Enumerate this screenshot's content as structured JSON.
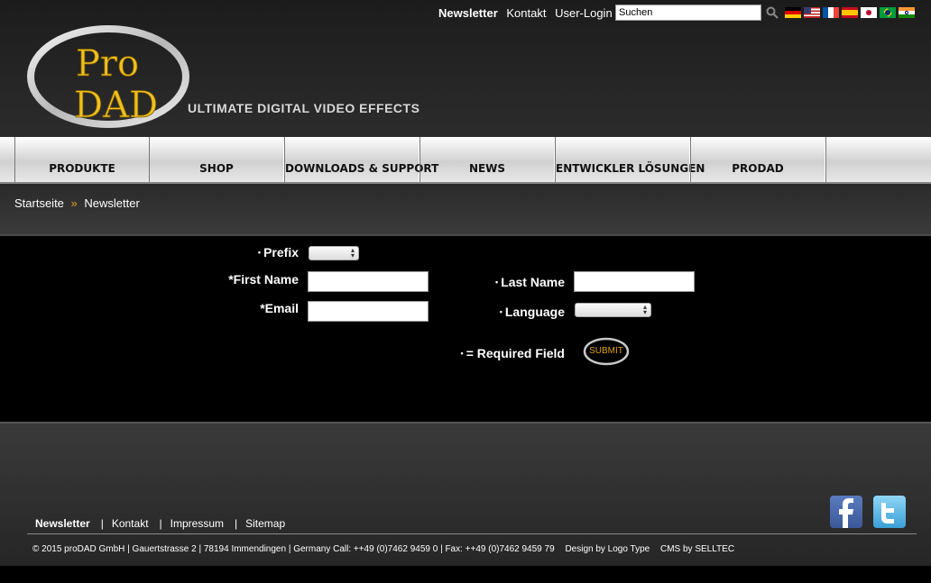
{
  "top_links": [
    "Newsletter",
    "Kontakt",
    "User-Login"
  ],
  "search": {
    "placeholder": "Suchen",
    "value": "Suchen"
  },
  "flags": [
    "de-flag",
    "us-flag",
    "fr-flag",
    "es-flag",
    "jp-flag",
    "br-flag",
    "in-flag"
  ],
  "logo": {
    "line1": "Pro",
    "line2": "DAD"
  },
  "slogan": "ULTIMATE DIGITAL VIDEO EFFECTS",
  "nav": [
    "PRODUKTE",
    "SHOP",
    "DOWNLOADS & SUPPORT",
    "NEWS",
    "ENTWICKLER LÖSUNGEN",
    "PRODAD"
  ],
  "breadcrumb": {
    "home": "Startseite",
    "separator": "»",
    "current": "Newsletter"
  },
  "form": {
    "prefix_label": "Prefix",
    "first_name_label": "*First Name",
    "email_label": "*Email",
    "last_name_label": "Last Name",
    "language_label": "Language",
    "required_note": "= Required Field",
    "submit_label": "SUBMIT"
  },
  "footer": {
    "links": [
      "Newsletter",
      "Kontakt",
      "Impressum",
      "Sitemap"
    ],
    "copyright": "© 2015 proDAD GmbH | Gauertstrasse 2 | 78194 Immendingen | Germany Call: ++49 (0)7462 9459 0 | Fax: ++49 (0)7462 9459 79",
    "design": "Design by Logo Type",
    "cms": "CMS by SELLTEC"
  },
  "colors": {
    "accent": "#e0a020",
    "logo_gold": "#f0c020",
    "facebook": "#3b5998",
    "twitter": "#4ab3e8"
  }
}
